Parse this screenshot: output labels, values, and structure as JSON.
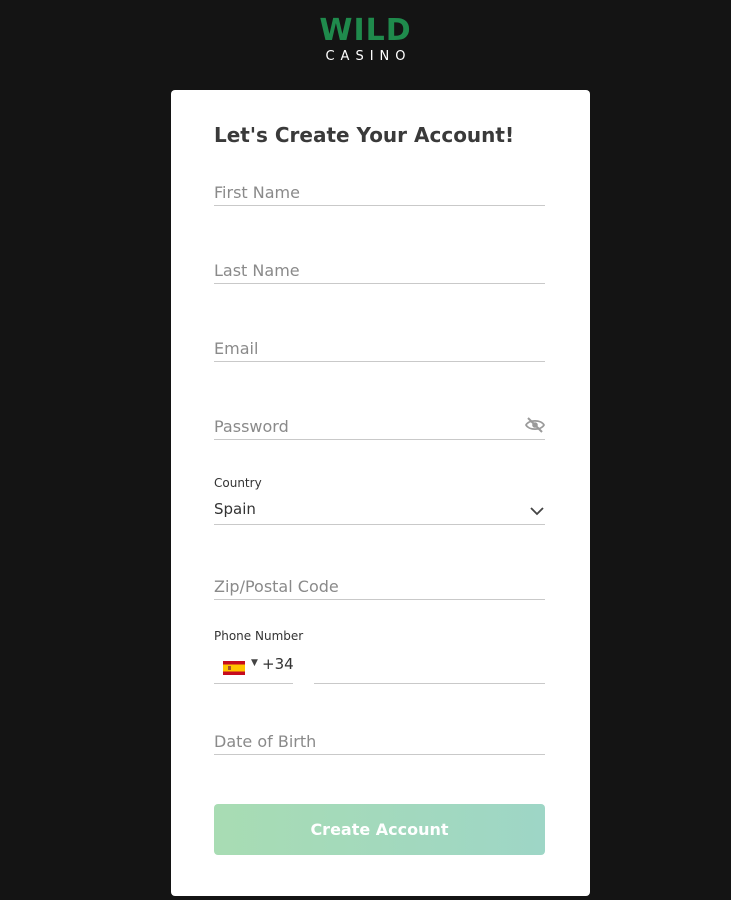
{
  "logo": {
    "line1": "WILD",
    "line2": "CASINO"
  },
  "form": {
    "title": "Let's Create Your Account!",
    "first_name_placeholder": "First Name",
    "last_name_placeholder": "Last Name",
    "email_placeholder": "Email",
    "password_placeholder": "Password",
    "country_label": "Country",
    "country_value": "Spain",
    "zip_placeholder": "Zip/Postal Code",
    "phone_label": "Phone Number",
    "phone_code": "+34",
    "dob_placeholder": "Date of Birth",
    "submit_label": "Create Account"
  },
  "colors": {
    "brand_green": "#1f8a4c",
    "button_gradient_start": "#a8dcb3",
    "button_gradient_end": "#9ed6c6"
  },
  "icons": {
    "password_toggle": "eye-slash-icon",
    "country_dropdown": "chevron-down-icon",
    "phone_country_flag": "spain-flag-icon",
    "phone_dropdown": "caret-down-icon"
  }
}
